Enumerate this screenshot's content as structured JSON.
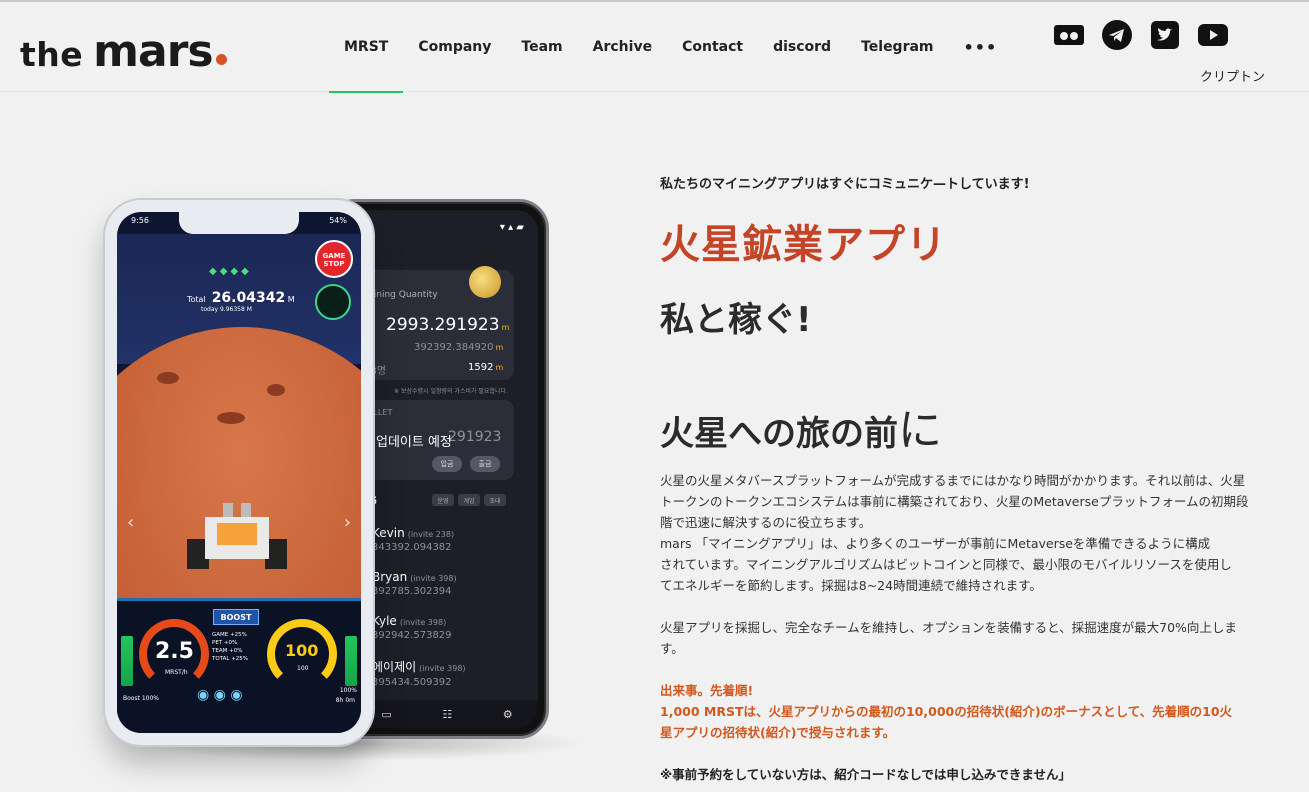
{
  "brand": {
    "word1": "the",
    "word2": "mars"
  },
  "nav": {
    "items": [
      {
        "label": "MRST",
        "active": true
      },
      {
        "label": "Company"
      },
      {
        "label": "Team"
      },
      {
        "label": "Archive"
      },
      {
        "label": "Contact"
      },
      {
        "label": "discord"
      },
      {
        "label": "Telegram"
      },
      {
        "label": "•••"
      }
    ]
  },
  "social": {
    "icons": [
      "bitcointalk-icon",
      "telegram-icon",
      "twitter-icon",
      "youtube-icon"
    ]
  },
  "language": "クリプトン",
  "phone_back": {
    "status": "▾ ▴ ▰",
    "mining_label": "Mining Quantity",
    "mining_total": "2993.291923",
    "unit": "m",
    "sub1": "392392.384920",
    "sub2_label": "98명",
    "sub2": "1592",
    "note": "※ 보상수령시 일정량의 가스비가 필요합니다.",
    "wallet_label": "ALLET",
    "update_text": "업데이트 예정",
    "update_bg": "291923",
    "btn1": "입금",
    "btn2": "출금",
    "section": "G",
    "tabs": [
      "운영",
      "게임",
      "초대"
    ],
    "rows": [
      {
        "name": "Kevin",
        "invite": "(invite 238)",
        "value": "343392.094382"
      },
      {
        "name": "Bryan",
        "invite": "(invite 398)",
        "value": "392785.302394"
      },
      {
        "name": "Kyle",
        "invite": "(invite 398)",
        "value": "392942.573829"
      },
      {
        "name": "에이제이",
        "invite": "(invite 398)",
        "value": "395434.509392"
      }
    ]
  },
  "phone_front": {
    "time": "9:56",
    "battery": "54%",
    "game_stop": "GAME STOP",
    "total_label": "Total",
    "total_value": "26.04342",
    "today_label": "today",
    "today_value": "9.96358",
    "unit": "M",
    "boost": "BOOST",
    "speed": "2.5",
    "speed_unit": "MRST/h",
    "right_gauge": "100",
    "right_gauge_sub": "100",
    "stats": [
      {
        "k": "GAME",
        "v": "+25%"
      },
      {
        "k": "PET",
        "v": "+0%"
      },
      {
        "k": "TEAM",
        "v": "+0%"
      },
      {
        "k": "TOTAL",
        "v": "+25%"
      }
    ],
    "boost_pct": "Boost 100%",
    "right_pct": "100%",
    "right_time": "8h 0m"
  },
  "content": {
    "eyebrow": "私たちのマイニングアプリはすぐにコミュニケ—トしています!",
    "title": "火星鉱業アプリ",
    "subtitle": "私と稼ぐ!",
    "heading_main": "火星への旅の前",
    "heading_big": "に",
    "p1_l1": "火星の火星メタバースプラットフォームが完成するまでにはかなり時間がかかります。それ以前は、火星",
    "p1_l2": "トークンのトークンエコシステムは事前に構築されており、火星のMetaverseプラットフォームの初期段",
    "p1_l3": "階で迅速に解決するのに役立ちます。",
    "p1_l4": "mars 「マイニングアプリ」は、より多くのユーザーが事前にMetaverseを準備できるように構成",
    "p1_l5": "されています。マイニングアルゴリズムはビットコインと同様で、最小限のモバイルリソースを使用し",
    "p1_l6": "てエネルギーを節約します。採掘は8~24時間連続で維持されます。",
    "p2_l1": "火星アプリを採掘し、完全なチームを維持し、オプションを装備すると、採掘速度が最大70%向上しま",
    "p2_l2": "す。",
    "event_l1": "出来事。先着順!",
    "event_l2": "1,000 MRSTは、火星アプリからの最初の10,000の招待状(紹介)のボーナスとして、先着順の10火",
    "event_l3": "星アプリの招待状(紹介)で授与されます。",
    "note": "※事前予約をしていない方は、紹介コードなしでは申し込みできません」"
  }
}
